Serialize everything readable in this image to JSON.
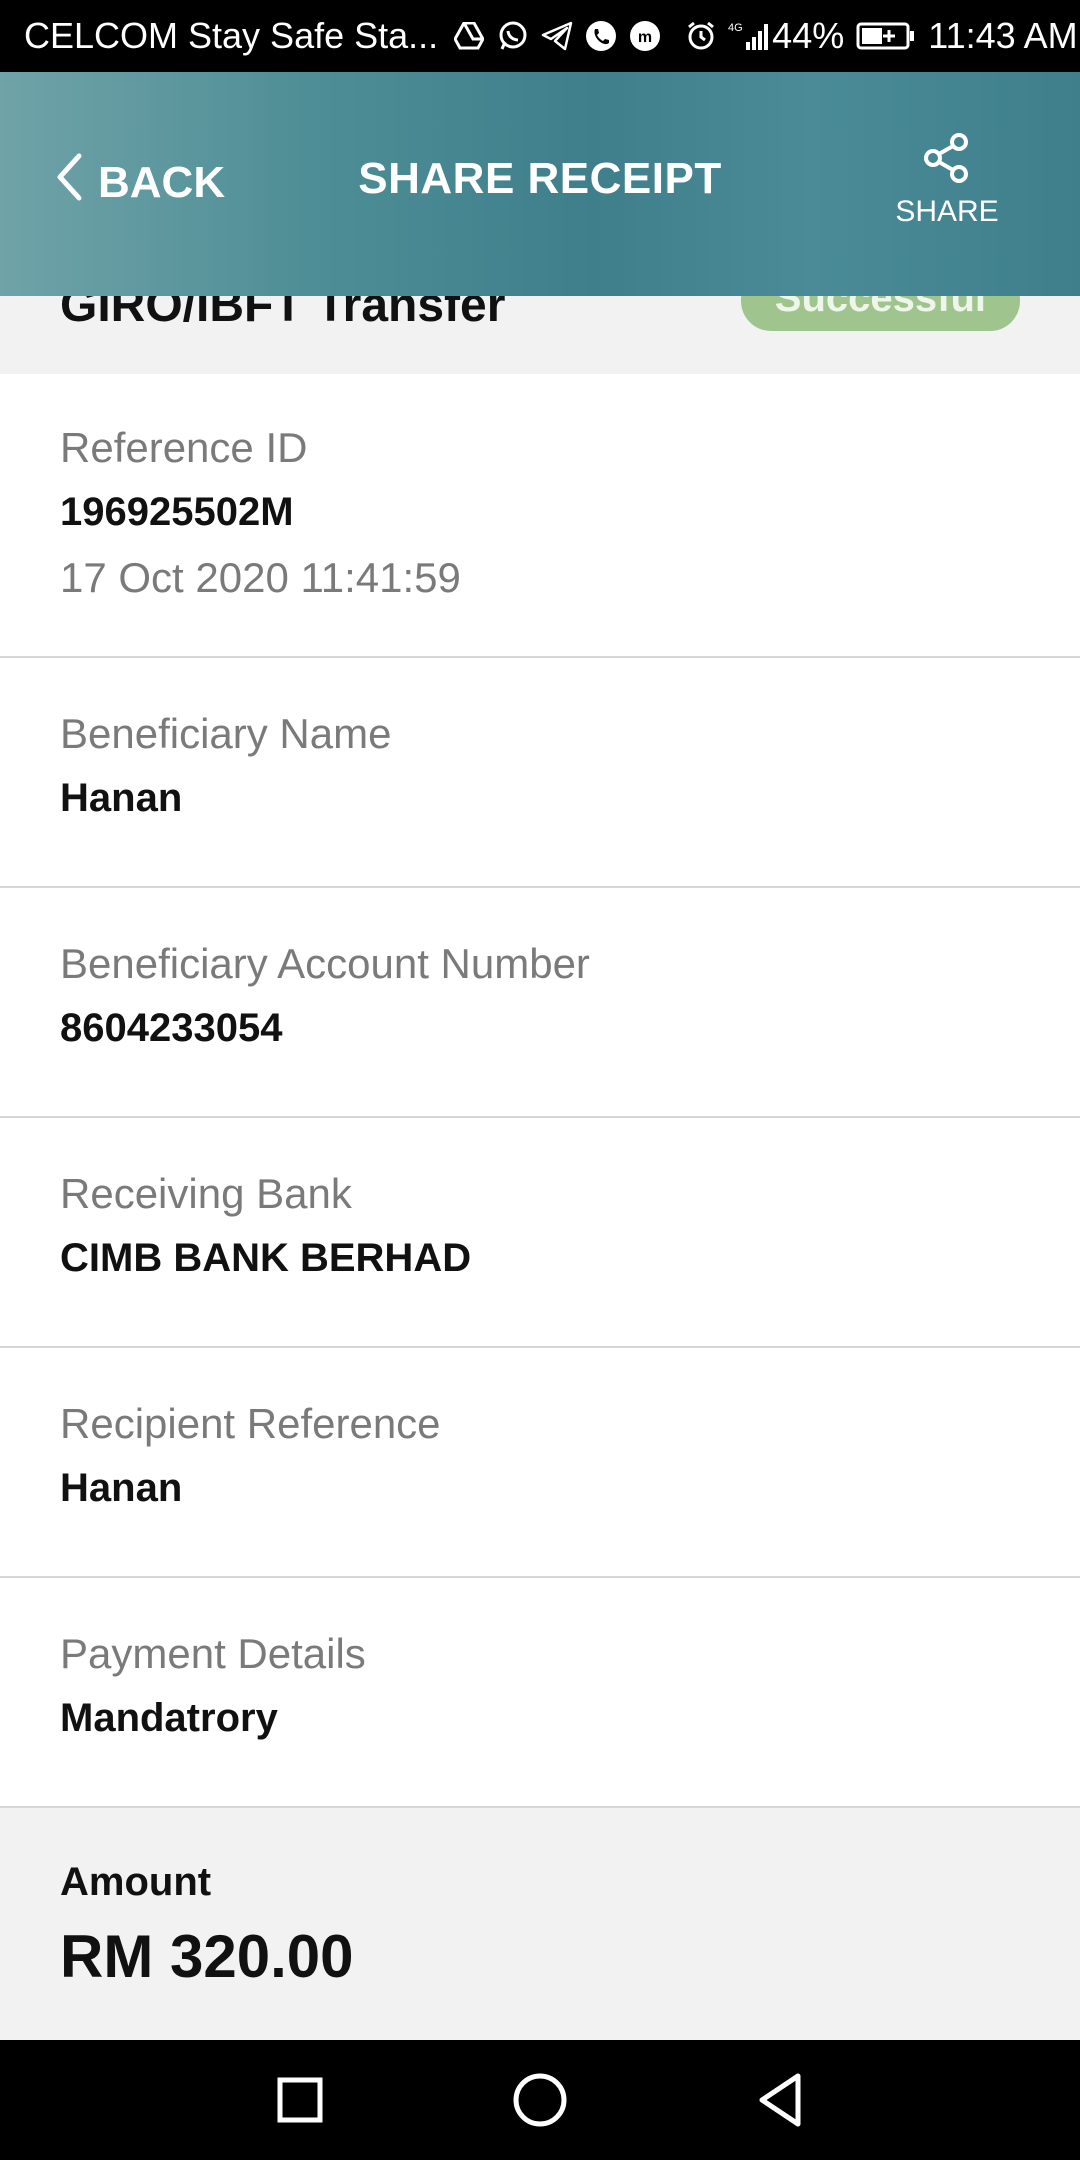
{
  "status_bar": {
    "carrier": "CELCOM Stay Safe Sta...",
    "network": "4G",
    "battery": "44%",
    "time": "11:43 AM",
    "icons": [
      "drive-icon",
      "whatsapp-icon",
      "telegram-icon",
      "phone-icon",
      "messenger-icon",
      "alarm-icon",
      "signal-icon",
      "battery-icon"
    ]
  },
  "header": {
    "back_label": "BACK",
    "title": "SHARE RECEIPT",
    "share_label": "SHARE"
  },
  "summary": {
    "transaction_type": "GIRO/IBFT Transfer",
    "status": "Successful"
  },
  "details": [
    {
      "label": "Reference ID",
      "value": "196925502M",
      "sub": "17 Oct 2020 11:41:59"
    },
    {
      "label": "Beneficiary Name",
      "value": "Hanan"
    },
    {
      "label": "Beneficiary Account Number",
      "value": "8604233054"
    },
    {
      "label": "Receiving Bank",
      "value": "CIMB BANK BERHAD"
    },
    {
      "label": "Recipient Reference",
      "value": "Hanan"
    },
    {
      "label": "Payment Details",
      "value": "Mandatrory"
    }
  ],
  "amount": {
    "label": "Amount",
    "value": "RM 320.00"
  },
  "colors": {
    "header": "#3f7f8c",
    "success_badge": "#9fc48e",
    "label_gray": "#7a7a7a"
  }
}
